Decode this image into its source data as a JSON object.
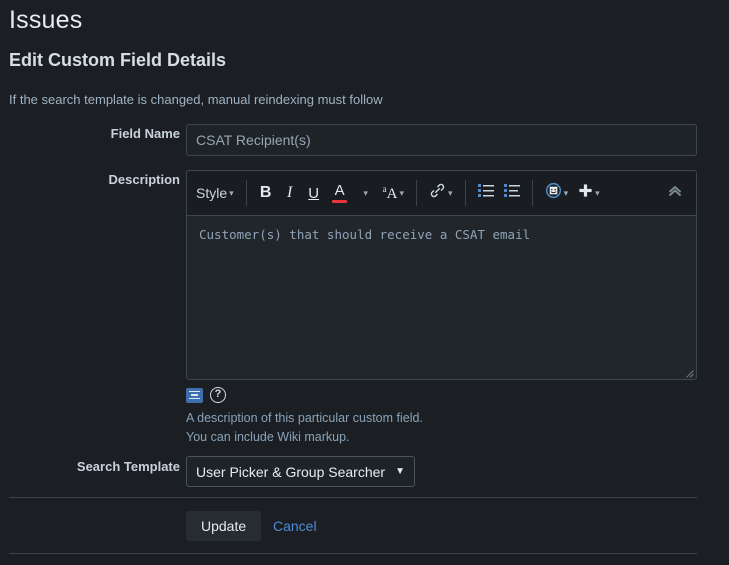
{
  "header": {
    "app_title": "Issues",
    "page_heading": "Edit Custom Field Details",
    "subtext": "If the search template is changed, manual reindexing must follow"
  },
  "form": {
    "field_name": {
      "label": "Field Name",
      "value": "CSAT Recipient(s)",
      "placeholder": "CSAT Recipient(s)"
    },
    "description": {
      "label": "Description",
      "value": "Customer(s) that should receive a CSAT email",
      "help_line_1": "A description of this particular custom field.",
      "help_line_2": "You can include Wiki markup.",
      "preview_icon": "preview-icon",
      "help_icon": "help-circle-icon"
    },
    "search_template": {
      "label": "Search Template",
      "selected": "User Picker & Group Searcher",
      "options": [
        "User Picker & Group Searcher"
      ]
    }
  },
  "toolbar": {
    "style_label": "Style",
    "bold_label": "B",
    "italic_label": "I",
    "underline_label": "U",
    "text_color_glyph": "A",
    "text_color_swatch": "#e8343a",
    "more_formatting_glyph": "A",
    "more_formatting_sup": "a",
    "link_icon": "link-icon",
    "bullet_list_icon": "bullet-list-icon",
    "numbered_list_icon": "numbered-list-icon",
    "emoji_icon": "emoji-icon",
    "insert_icon": "plus-icon",
    "collapse_icon": "chevron-double-up-icon",
    "caret_glyph": "⌄"
  },
  "footer": {
    "update_label": "Update",
    "cancel_label": "Cancel"
  },
  "colors": {
    "background": "#1b1f23",
    "link": "#4c8ddb",
    "accent_red": "#e8343a",
    "border": "#3c464f"
  }
}
